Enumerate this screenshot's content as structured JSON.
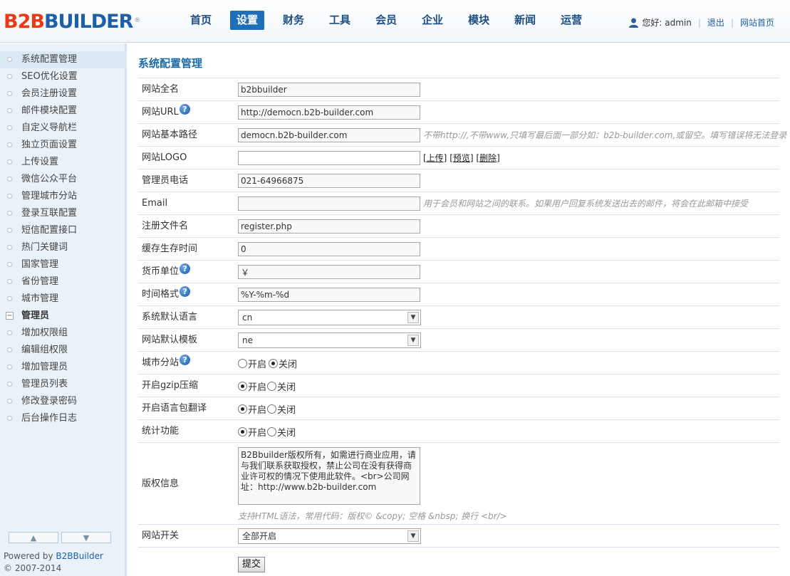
{
  "header": {
    "logo": {
      "part1": "B2B",
      "part2": "BUILDER",
      "mark": "®"
    },
    "nav": [
      {
        "label": "首页",
        "active": false
      },
      {
        "label": "设置",
        "active": true
      },
      {
        "label": "财务",
        "active": false
      },
      {
        "label": "工具",
        "active": false
      },
      {
        "label": "会员",
        "active": false
      },
      {
        "label": "企业",
        "active": false
      },
      {
        "label": "模块",
        "active": false
      },
      {
        "label": "新闻",
        "active": false
      },
      {
        "label": "运营",
        "active": false
      }
    ],
    "user": {
      "greeting": "您好: admin",
      "logout": "退出",
      "home": "网站首页",
      "icon": "user-icon"
    }
  },
  "sidebar": {
    "items": [
      "系统配置管理",
      "SEO优化设置",
      "会员注册设置",
      "邮件模块配置",
      "自定义导航栏",
      "独立页面设置",
      "上传设置",
      "微信公众平台",
      "管理城市分站",
      "登录互联配置",
      "短信配置接口",
      "热门关键词",
      "国家管理",
      "省份管理",
      "城市管理"
    ],
    "group": "管理员",
    "group_items": [
      "增加权限组",
      "编辑组权限",
      "增加管理员",
      "管理员列表",
      "修改登录密码",
      "后台操作日志"
    ],
    "powered_prefix": "Powered by ",
    "powered_brand": "B2BBuilder",
    "copyright": "© 2007-2014"
  },
  "main": {
    "title": "系统配置管理",
    "fields": {
      "site_name": {
        "label": "网站全名",
        "value": "b2bbuilder"
      },
      "site_url": {
        "label": "网站URL",
        "value": "http://democn.b2b-builder.com"
      },
      "base_path": {
        "label": "网站基本路径",
        "value": "democn.b2b-builder.com",
        "hint": "不带http://,不带www,只填写最后面一部分如：b2b-builder.com,或留空。填写错误将无法登录"
      },
      "logo": {
        "label": "网站LOGO",
        "value": "",
        "upload": "[上传]",
        "preview": "[预览]",
        "delete": "[删除]"
      },
      "admin_phone": {
        "label": "管理员电话",
        "value": "021-64966875"
      },
      "email": {
        "label": "Email",
        "value": "",
        "hint": "用于会员和网站之间的联系。如果用户回复系统发送出去的邮件，将会在此邮箱中接受"
      },
      "register_file": {
        "label": "注册文件名",
        "value": "register.php"
      },
      "cache_time": {
        "label": "缓存生存时间",
        "value": "0"
      },
      "currency": {
        "label": "货币单位",
        "value": "￥"
      },
      "time_format": {
        "label": "时间格式",
        "value": "%Y-%m-%d"
      },
      "language": {
        "label": "系统默认语言",
        "value": "cn"
      },
      "template": {
        "label": "网站默认模板",
        "value": "ne"
      },
      "city_site": {
        "label": "城市分站",
        "on": "开启",
        "off": "关闭",
        "selected": "off"
      },
      "gzip": {
        "label": "开启gzip压缩",
        "on": "开启",
        "off": "关闭",
        "selected": "on"
      },
      "lang_pack": {
        "label": "开启语言包翻译",
        "on": "开启",
        "off": "关闭",
        "selected": "on"
      },
      "stats": {
        "label": "统计功能",
        "on": "开启",
        "off": "关闭",
        "selected": "on"
      },
      "copyright": {
        "label": "版权信息",
        "value": "B2Bbuilder版权所有，如需进行商业应用，请与我们联系获取授权，禁止公司在没有获得商业许可权的情况下使用此软件。<br>公司网址：http://www.b2b-builder.com",
        "hint": "支持HTML语法，常用代码：版权© &copy; 空格 &nbsp; 换行 <br/>"
      },
      "site_switch": {
        "label": "网站开关",
        "value": "全部开启"
      }
    },
    "submit": "提交"
  }
}
